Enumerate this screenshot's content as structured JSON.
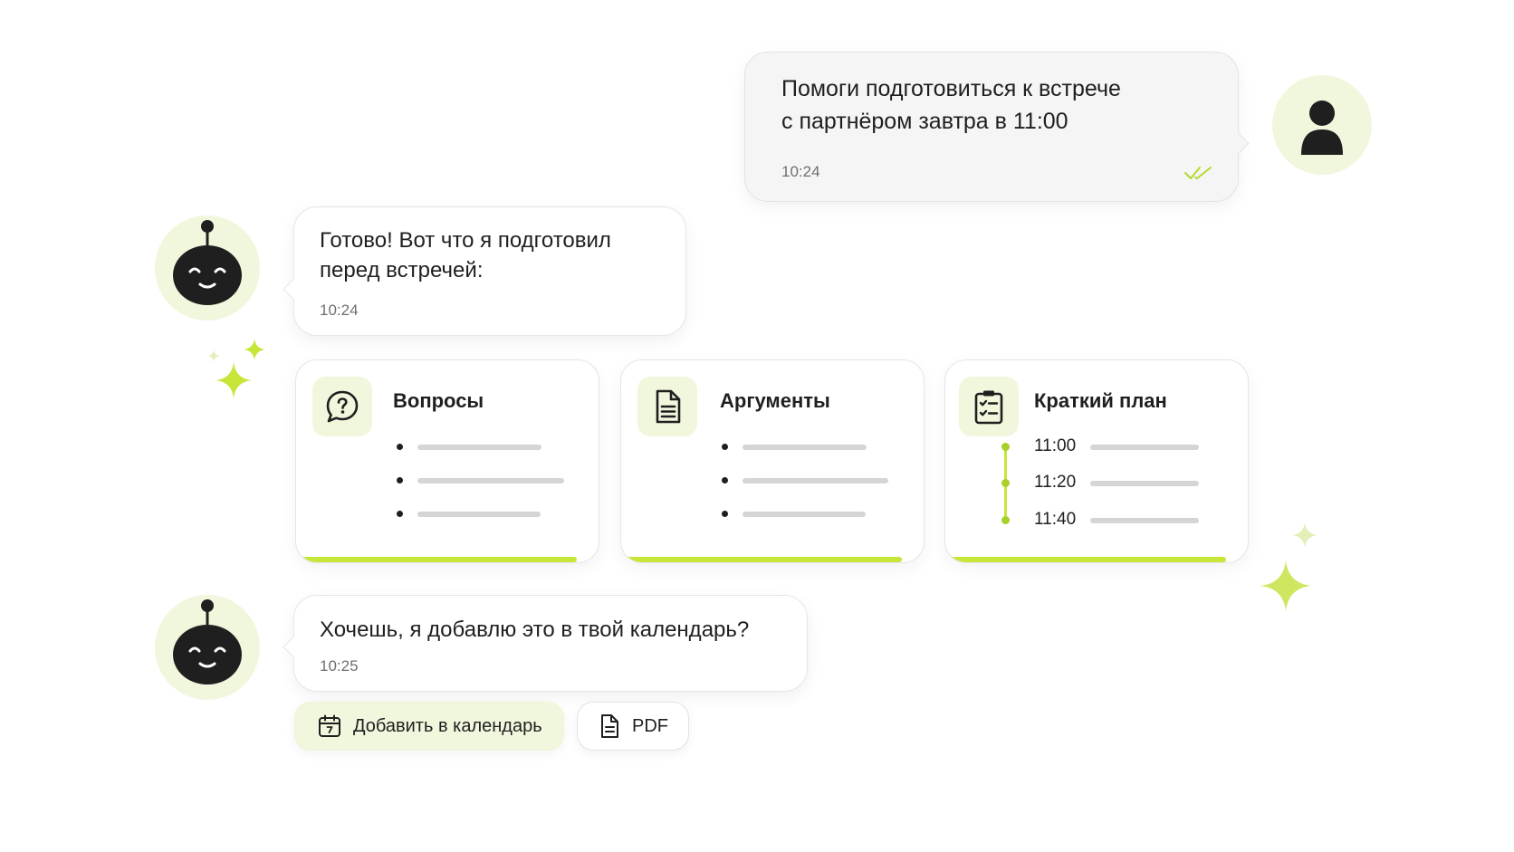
{
  "colors": {
    "accent": "#c6e63a",
    "accent_soft": "#f1f7dc",
    "ink": "#1f1f1f",
    "muted": "#6f6f6f"
  },
  "user_message": {
    "text": "Помоги подготовиться к встрече\nс партнёром завтра в 11:00",
    "time": "10:24",
    "status_icon": "double-check-icon"
  },
  "bot_message_1": {
    "text": "Готово! Вот что я подготовил\nперед встречей:",
    "time": "10:24"
  },
  "cards": [
    {
      "title": "Вопросы",
      "icon": "question-bubble-icon",
      "items": 3
    },
    {
      "title": "Аргументы",
      "icon": "document-icon",
      "items": 3
    },
    {
      "title": "Краткий план",
      "icon": "checklist-icon",
      "times": [
        "11:00",
        "11:20",
        "11:40"
      ]
    }
  ],
  "bot_message_2": {
    "text": "Хочешь, я добавлю это в твой календарь?",
    "time": "10:25"
  },
  "actions": {
    "add_calendar_label": "Добавить в календарь",
    "pdf_label": "PDF"
  }
}
